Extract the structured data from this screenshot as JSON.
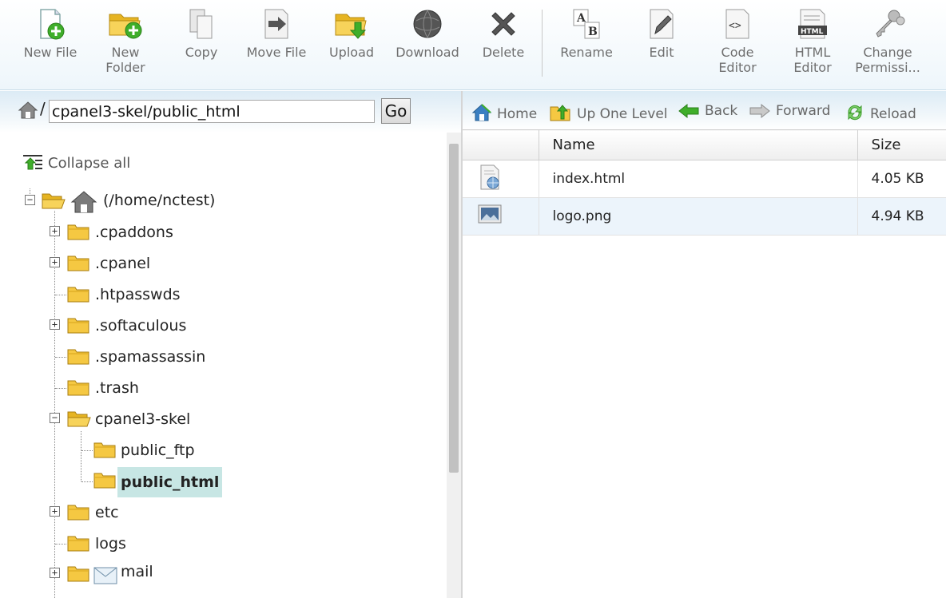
{
  "toolbar": {
    "buttons": [
      {
        "label": "New File",
        "icon": "new-file-icon"
      },
      {
        "label": "New\nFolder",
        "icon": "new-folder-icon"
      },
      {
        "label": "Copy",
        "icon": "copy-icon"
      },
      {
        "label": "Move File",
        "icon": "move-file-icon"
      },
      {
        "label": "Upload",
        "icon": "upload-icon"
      },
      {
        "label": "Download",
        "icon": "download-icon"
      },
      {
        "label": "Delete",
        "icon": "delete-icon"
      },
      {
        "label": "Rename",
        "icon": "rename-icon"
      },
      {
        "label": "Edit",
        "icon": "edit-icon"
      },
      {
        "label": "Code\nEditor",
        "icon": "code-editor-icon"
      },
      {
        "label": "HTML\nEditor",
        "icon": "html-editor-icon"
      },
      {
        "label": "Change\nPermissi...",
        "icon": "permissions-icon"
      }
    ]
  },
  "path_bar": {
    "slash": "/",
    "value": "cpanel3-skel/public_html",
    "go_label": "Go"
  },
  "tree": {
    "collapse_all": "Collapse all",
    "root_label": "(/home/nctest)",
    "nodes": [
      {
        "label": ".cpaddons",
        "toggle": "+"
      },
      {
        "label": ".cpanel",
        "toggle": "+"
      },
      {
        "label": ".htpasswds",
        "toggle": ""
      },
      {
        "label": ".softaculous",
        "toggle": "+"
      },
      {
        "label": ".spamassassin",
        "toggle": ""
      },
      {
        "label": ".trash",
        "toggle": ""
      },
      {
        "label": "cpanel3-skel",
        "toggle": "−"
      },
      {
        "label": "public_ftp",
        "toggle": ""
      },
      {
        "label": "public_html",
        "toggle": "",
        "selected": true
      },
      {
        "label": "etc",
        "toggle": "+"
      },
      {
        "label": "logs",
        "toggle": ""
      },
      {
        "label": "mail",
        "toggle": "+"
      }
    ]
  },
  "nav": {
    "home": "Home",
    "up": "Up One Level",
    "back": "Back",
    "forward": "Forward",
    "reload": "Reload"
  },
  "table": {
    "headers": {
      "name": "Name",
      "size": "Size"
    },
    "rows": [
      {
        "name": "index.html",
        "size": "4.05 KB",
        "icon": "html-file-icon"
      },
      {
        "name": "logo.png",
        "size": "4.94 KB",
        "icon": "image-file-icon"
      }
    ]
  },
  "colors": {
    "selection": "#c7e6e4",
    "folder": "#f5c842",
    "accent_green": "#3fae2a"
  }
}
